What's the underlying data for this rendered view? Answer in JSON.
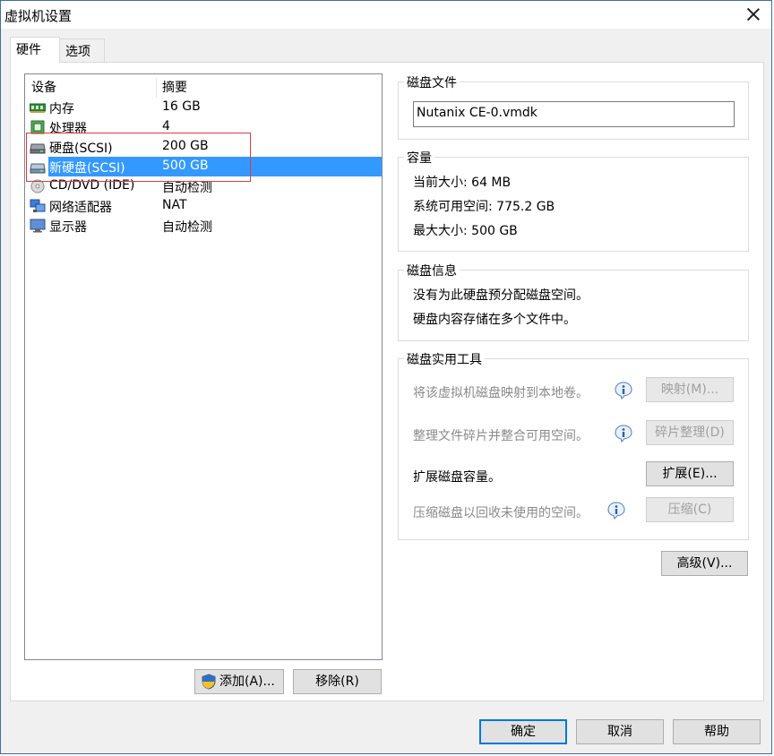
{
  "window": {
    "title": "虚拟机设置"
  },
  "tabs": [
    {
      "label": "硬件"
    },
    {
      "label": "选项"
    }
  ],
  "device_list": {
    "headers": {
      "device": "设备",
      "summary": "摘要"
    },
    "rows": [
      {
        "name": "内存",
        "summary": "16 GB",
        "icon": "memory-icon"
      },
      {
        "name": "处理器",
        "summary": "4",
        "icon": "processor-icon"
      },
      {
        "name": "硬盘(SCSI)",
        "summary": "200 GB",
        "icon": "hard-disk-icon"
      },
      {
        "name": "新硬盘(SCSI)",
        "summary": "500 GB",
        "icon": "hard-disk-icon",
        "selected": true
      },
      {
        "name": "CD/DVD (IDE)",
        "summary": "自动检测",
        "icon": "cd-dvd-icon"
      },
      {
        "name": "网络适配器",
        "summary": "NAT",
        "icon": "network-adapter-icon"
      },
      {
        "name": "显示器",
        "summary": "自动检测",
        "icon": "monitor-icon"
      }
    ],
    "add_button": "添加(A)...",
    "remove_button": "移除(R)"
  },
  "disk_file": {
    "title": "磁盘文件",
    "value": "Nutanix CE-0.vmdk"
  },
  "capacity": {
    "title": "容量",
    "current_size": "当前大小: 64 MB",
    "system_free": "系统可用空间: 775.2 GB",
    "max_size": "最大大小: 500 GB"
  },
  "disk_info": {
    "title": "磁盘信息",
    "line1": "没有为此硬盘预分配磁盘空间。",
    "line2": "硬盘内容存储在多个文件中。"
  },
  "disk_utilities": {
    "title": "磁盘实用工具",
    "map_text": "将该虚拟机磁盘映射到本地卷。",
    "map_button": "映射(M)...",
    "defrag_text": "整理文件碎片并整合可用空间。",
    "defrag_button": "碎片整理(D)",
    "expand_text": "扩展磁盘容量。",
    "expand_button": "扩展(E)...",
    "compact_text": "压缩磁盘以回收未使用的空间。",
    "compact_button": "压缩(C)"
  },
  "advanced_button": "高级(V)...",
  "footer": {
    "ok": "确定",
    "cancel": "取消",
    "help": "帮助"
  },
  "colors": {
    "selection": "#3399ff",
    "accent": "#0078d7",
    "highlight_box": "#e03a3a"
  }
}
